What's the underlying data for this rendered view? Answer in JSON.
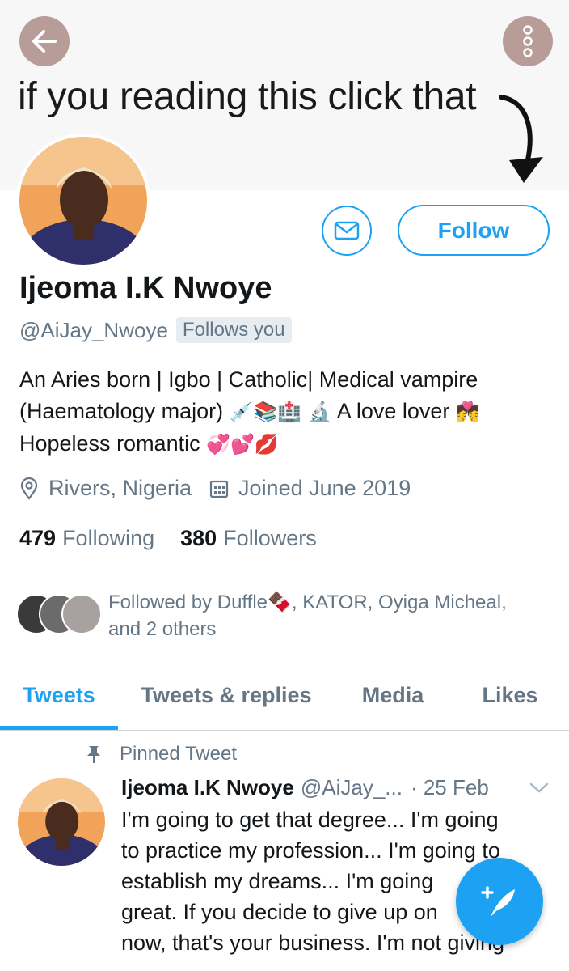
{
  "banner": {
    "text": "if you reading this click that",
    "back_icon": "arrow-left-icon",
    "more_icon": "vertical-dots-icon"
  },
  "profile": {
    "name": "Ijeoma I.K Nwoye",
    "handle": "@AiJay_Nwoye",
    "follows_you": "Follows you",
    "follow_label": "Follow",
    "message_icon": "envelope-icon",
    "bio_line1": "An Aries born | Igbo | Catholic| Medical vampire",
    "bio_line2_text": "(Haematology major)",
    "bio_line2_emoji": "💉📚🏥 🔬",
    "bio_line2_tail": "A love lover",
    "bio_line2_emoji2": "💏",
    "bio_line3_text": "Hopeless romantic",
    "bio_line3_emoji": "💞💕💋",
    "location": "Rivers, Nigeria",
    "joined": "Joined June 2019",
    "following_count": "479",
    "following_label": "Following",
    "followers_count": "380",
    "followers_label": "Followers",
    "followed_by_line1": "Followed by Duffle🍫, KATOR, Oyiga Micheal,",
    "followed_by_line2": "and 2 others"
  },
  "tabs": [
    {
      "label": "Tweets",
      "active": true
    },
    {
      "label": "Tweets & replies",
      "active": false
    },
    {
      "label": "Media",
      "active": false
    },
    {
      "label": "Likes",
      "active": false
    }
  ],
  "tweet": {
    "pinned_label": "Pinned Tweet",
    "name": "Ijeoma I.K Nwoye",
    "handle": "@AiJay_...",
    "date": "· 25 Feb",
    "lines": [
      "I'm going to get that degree... I'm going",
      "to practice my profession... I'm going to",
      "establish my dreams... I'm going",
      "great. If you decide to give up on",
      "now, that's your business. I'm not giving"
    ]
  },
  "colors": {
    "accent": "#1da1f2",
    "muted": "#657786",
    "round_button": "#b89c98"
  }
}
